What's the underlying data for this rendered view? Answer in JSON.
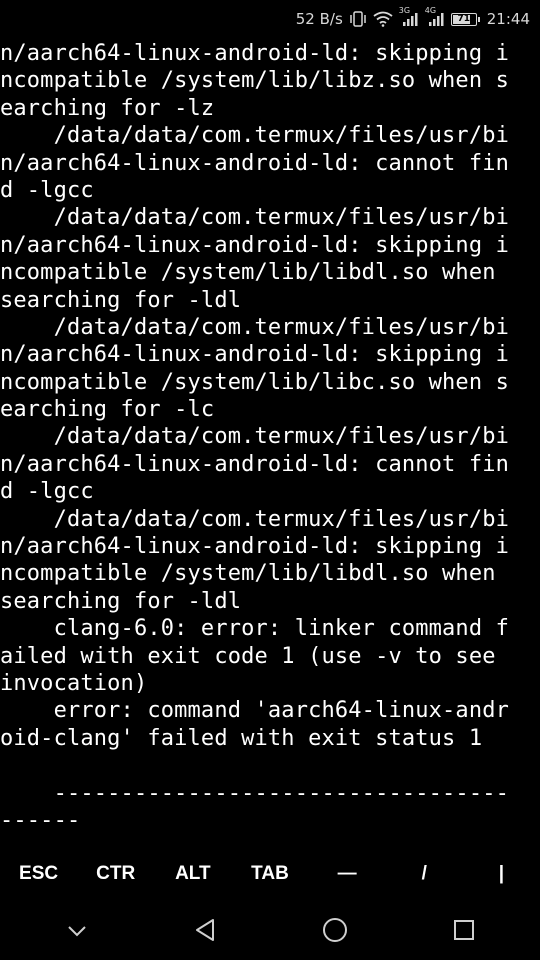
{
  "status_bar": {
    "net_speed": "52 B/s",
    "network_label": "3G",
    "network_label_2": "4G",
    "battery_level": "71",
    "time": "21:44",
    "icons": [
      "vibrate-icon",
      "wifi-icon",
      "signal-3g-icon",
      "signal-4g-icon",
      "battery-icon"
    ]
  },
  "terminal": {
    "lines": [
      "n/aarch64-linux-android-ld: skipping i",
      "ncompatible /system/lib/libz.so when s",
      "earching for -lz",
      "    /data/data/com.termux/files/usr/bi",
      "n/aarch64-linux-android-ld: cannot fin",
      "d -lgcc",
      "    /data/data/com.termux/files/usr/bi",
      "n/aarch64-linux-android-ld: skipping i",
      "ncompatible /system/lib/libdl.so when",
      "searching for -ldl",
      "    /data/data/com.termux/files/usr/bi",
      "n/aarch64-linux-android-ld: skipping i",
      "ncompatible /system/lib/libc.so when s",
      "earching for -lc",
      "    /data/data/com.termux/files/usr/bi",
      "n/aarch64-linux-android-ld: cannot fin",
      "d -lgcc",
      "    /data/data/com.termux/files/usr/bi",
      "n/aarch64-linux-android-ld: skipping i",
      "ncompatible /system/lib/libdl.so when",
      "searching for -ldl",
      "    clang-6.0: error: linker command f",
      "ailed with exit code 1 (use -v to see",
      "invocation)",
      "    error: command 'aarch64-linux-andr",
      "oid-clang' failed with exit status 1",
      "",
      "    ----------------------------------",
      "------"
    ]
  },
  "extra_keys": [
    "ESC",
    "CTR",
    "ALT",
    "TAB",
    "—",
    "/",
    "|"
  ],
  "nav_bar": {
    "buttons": [
      "hide-keyboard-icon",
      "back-icon",
      "home-icon",
      "recents-icon"
    ]
  },
  "colors": {
    "background": "#000000",
    "text": "#ffffff",
    "status_text": "#d8d8d8"
  }
}
